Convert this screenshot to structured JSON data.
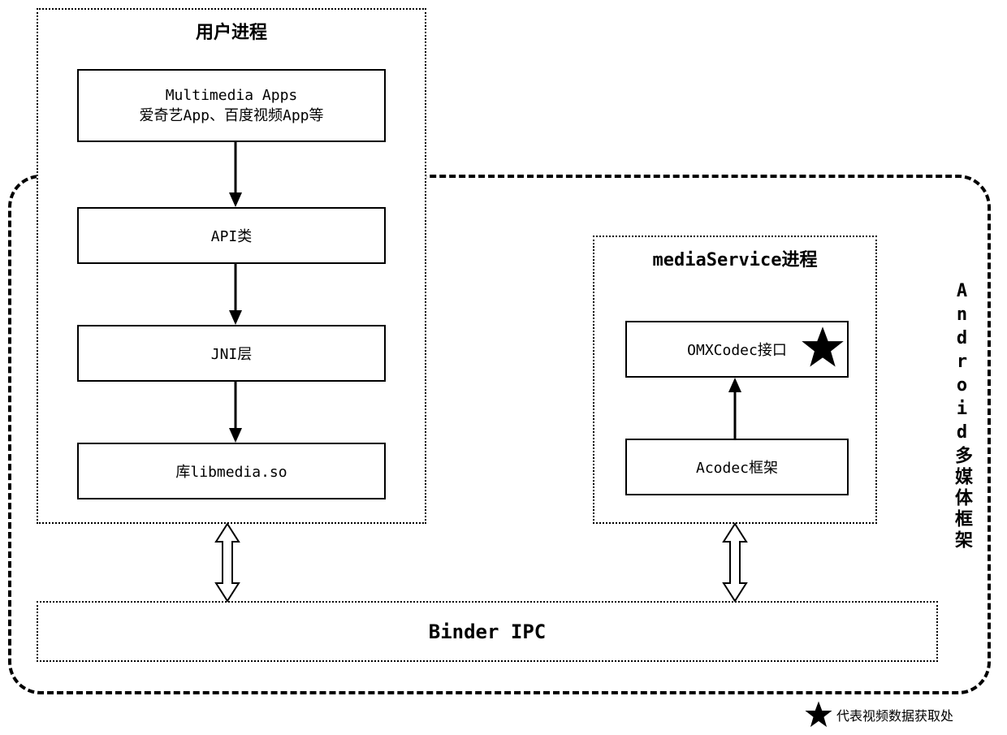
{
  "diagram": {
    "userProcess": {
      "title": "用户进程",
      "apps_line1": "Multimedia Apps",
      "apps_line2": "爱奇艺App、百度视频App等",
      "api": "API类",
      "jni": "JNI层",
      "lib": "库libmedia.so"
    },
    "framework": {
      "label": "Android多媒体框架"
    },
    "mediaService": {
      "title": "mediaService进程",
      "omx": "OMXCodec接口",
      "acodec": "Acodec框架"
    },
    "binder": "Binder IPC",
    "legend": "代表视频数据获取处"
  }
}
